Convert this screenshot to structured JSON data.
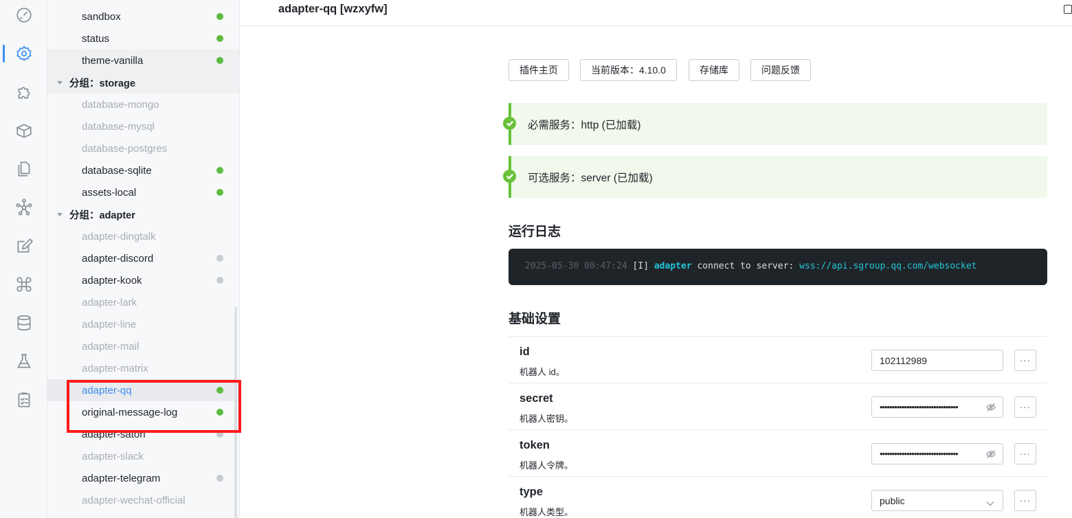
{
  "header": {
    "title": "adapter-qq [wzxyfw]"
  },
  "activity_bar": [
    {
      "icon": "dashboard-icon"
    },
    {
      "icon": "gear-icon",
      "active": true
    },
    {
      "icon": "puzzle-icon"
    },
    {
      "icon": "package-icon"
    },
    {
      "icon": "files-icon"
    },
    {
      "icon": "network-icon"
    },
    {
      "icon": "edit-icon"
    },
    {
      "icon": "command-icon"
    },
    {
      "icon": "database-icon"
    },
    {
      "icon": "flask-icon"
    },
    {
      "icon": "clipboard-icon"
    }
  ],
  "tree": {
    "items_top": [
      {
        "label": "sandbox",
        "status": "green"
      },
      {
        "label": "status",
        "status": "green"
      },
      {
        "label": "theme-vanilla",
        "status": "green"
      }
    ],
    "group_storage": {
      "label": "分组：storage",
      "items": [
        {
          "label": "database-mongo",
          "status": "off"
        },
        {
          "label": "database-mysql",
          "status": "off"
        },
        {
          "label": "database-postgres",
          "status": "off"
        },
        {
          "label": "database-sqlite",
          "status": "green"
        },
        {
          "label": "assets-local",
          "status": "green"
        }
      ]
    },
    "group_adapter": {
      "label": "分组：adapter",
      "items": [
        {
          "label": "adapter-dingtalk",
          "status": "off"
        },
        {
          "label": "adapter-discord",
          "status": "gray"
        },
        {
          "label": "adapter-kook",
          "status": "gray"
        },
        {
          "label": "adapter-lark",
          "status": "off"
        },
        {
          "label": "adapter-line",
          "status": "off"
        },
        {
          "label": "adapter-mail",
          "status": "off"
        },
        {
          "label": "adapter-matrix",
          "status": "off"
        },
        {
          "label": "adapter-qq",
          "status": "green",
          "selected": true
        },
        {
          "label": "original-message-log",
          "status": "green"
        },
        {
          "label": "adapter-satori",
          "status": "gray"
        },
        {
          "label": "adapter-slack",
          "status": "off"
        },
        {
          "label": "adapter-telegram",
          "status": "gray"
        },
        {
          "label": "adapter-wechat-official",
          "status": "off"
        }
      ]
    }
  },
  "actions": {
    "homepage": "插件主页",
    "version": "当前版本：4.10.0",
    "repository": "存储库",
    "feedback": "问题反馈"
  },
  "services": {
    "required": "必需服务：http (已加载)",
    "optional": "可选服务：server (已加载)"
  },
  "log_section": {
    "title": "运行日志",
    "entry": {
      "timestamp": "2025-05-30 00:47:24",
      "level": "[I]",
      "name": "adapter",
      "message": "connect to server:",
      "url": "wss://api.sgroup.qq.com/websocket"
    }
  },
  "basic_settings": {
    "title": "基础设置",
    "fields": {
      "id": {
        "key": "id",
        "desc": "机器人 id。",
        "value": "102112989"
      },
      "secret": {
        "key": "secret",
        "desc": "机器人密钥。",
        "value": "••••••••••••••••••••••••••••••••"
      },
      "token": {
        "key": "token",
        "desc": "机器人令牌。",
        "value": "••••••••••••••••••••••••••••••••"
      },
      "type": {
        "key": "type",
        "desc": "机器人类型。",
        "value": "public"
      }
    },
    "more_label": "···"
  },
  "colors": {
    "accent": "#3d8ef0",
    "success": "#67c23a",
    "highlight": "#ff1a1a"
  }
}
